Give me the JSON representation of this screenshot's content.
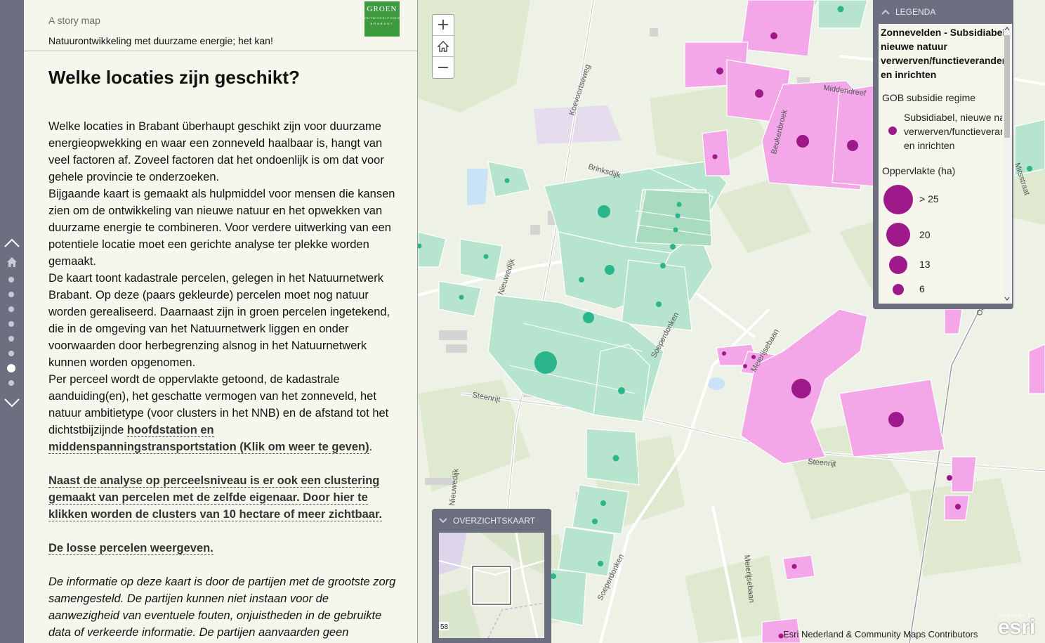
{
  "header": {
    "kicker": "A story map",
    "subtitle": "Natuurontwikkeling met duurzame energie; het kan!",
    "logo": {
      "line1": "GROEN",
      "line2": "ONTWIKKELFONDS",
      "line3": "BRABANT"
    }
  },
  "section": {
    "title": "Welke locaties zijn geschikt?",
    "paragraphs": [
      "Welke locaties in Brabant überhaupt geschikt zijn voor duurzame energieopwekking en waar een zonneveld haalbaar is, hangt van veel factoren af. Zoveel factoren dat het ondoenlijk is om dat voor gehele provincie te onderzoeken.",
      "Bijgaande kaart is gemaakt als hulpmiddel voor mensen die kansen zien om de ontwikkeling van nieuwe natuur en het opwekken van duurzame energie te combineren. Voor verdere uitwerking van een potentiele locatie moet een gerichte analyse ter plekke worden gemaakt.",
      "De kaart toont kadastrale percelen, gelegen in het Natuurnetwerk Brabant. Op deze (paars gekleurde) percelen moet nog natuur worden gerealiseerd. Daarnaast zijn in groen percelen ingetekend, die in de omgeving van het Natuurnetwerk liggen en onder voorwaarden door herbegrenzing alsnog in het Natuurnetwerk kunnen worden opgenomen."
    ],
    "p4_text": "Per perceel wordt de oppervlakte getoond, de kadastrale aanduiding(en), het geschatte vermogen van het zonneveld, het natuur ambitietype (voor clusters in het NNB) en de afstand tot het dichtstbijzijnde ",
    "p4_link": "hoofdstation en middenspanningstransportstation (Klik om weer te geven)",
    "p4_end": ".",
    "cluster_link": "Naast de analyse op perceelsniveau is er ook een clustering gemaakt van percelen met de zelfde eigenaar. Door hier te klikken worden de clusters van 10 hectare of meer zichtbaar.",
    "parcels_link": "De losse percelen weergeven.",
    "disclaimer": "De informatie op deze kaart is door de partijen met de grootste zorg samengesteld. De partijen kunnen niet instaan voor de aanwezigheid van eventuele fouten, onjuistheden in de gebruikte data of verkeerde informatie. De partijen aanvaarden geen aansprakelijkheid voor enige schade veroorzaakt door het gebruik"
  },
  "nav": {
    "dot_count": 8,
    "active_index": 6
  },
  "map": {
    "zoom_in": "+",
    "zoom_out": "−",
    "streets": [
      "Koevoortseweg",
      "Brinksdijk",
      "Middendreef",
      "Beukenbroek",
      "Nieuwedijk",
      "Soeperdonken",
      "Steenrijt",
      "Meierijsebaan",
      "Mitsstraat",
      "Steenrijt",
      "Nieuwedijk",
      "Soeperdonken",
      "Meierijsebaan",
      "Oirschot",
      "58"
    ],
    "attribution": "Esri Nederland & Community Maps Contributors",
    "esri_powered": "POWERED BY",
    "esri_name": "esri",
    "colors": {
      "purple_parcel": "#f3a6e8",
      "purple_dot": "#9e1a8a",
      "green_parcel": "#b7e4cf",
      "green_dot": "#2bb58a"
    }
  },
  "legend": {
    "title": "LEGENDA",
    "layer_title": "Zonnevelden - Subsidiabel nieuwe natuur verwerven/functieverandering en inrichten",
    "layer_lines": [
      "Zonnevelden - Subsidiabel",
      "nieuwe natuur",
      "verwerven/functieverandering",
      "en inrichten"
    ],
    "field1": "GOB subsidie regime",
    "symbol_lines": [
      "Subsidiabel, nieuwe natuur",
      "verwerven/functieverandering",
      "en inrichten"
    ],
    "field2": "Oppervlakte (ha)",
    "sizes": [
      {
        "label": "> 25"
      },
      {
        "label": "20"
      },
      {
        "label": "13"
      },
      {
        "label": "6"
      }
    ]
  },
  "overview": {
    "title": "OVERZICHTSKAART",
    "marker": "58"
  }
}
